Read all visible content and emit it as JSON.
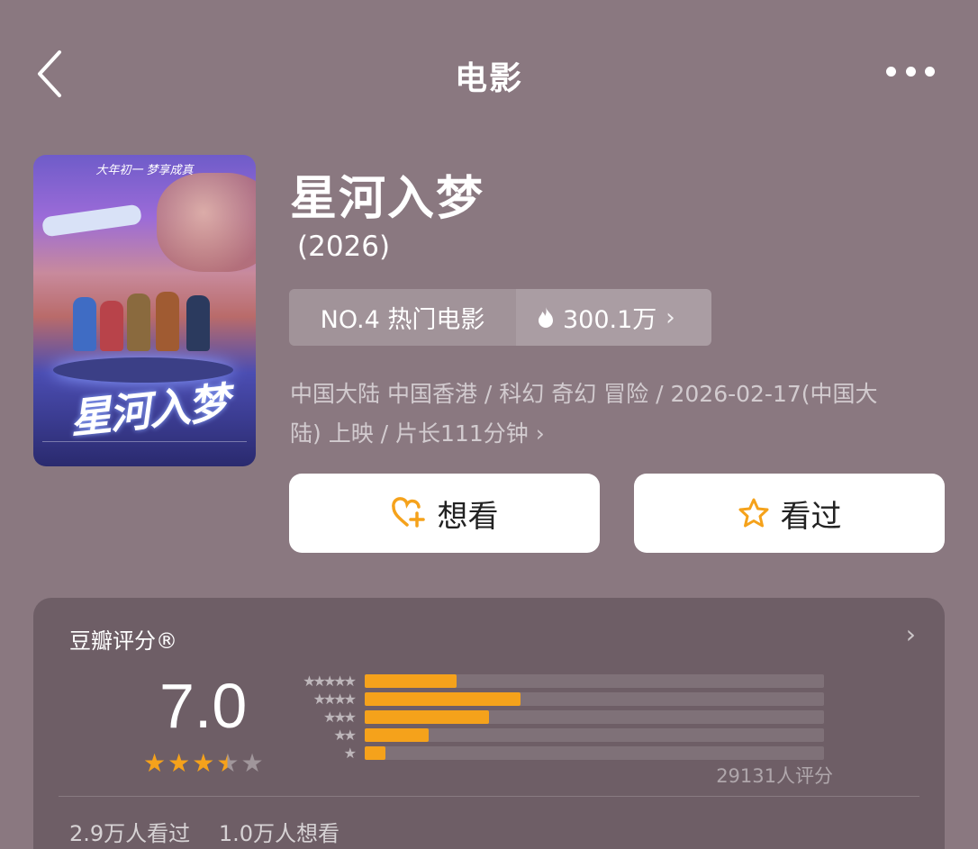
{
  "nav": {
    "title": "电影",
    "back_icon": "chevron-left-icon",
    "more_icon": "more-dots-icon"
  },
  "movie": {
    "name": "星河入梦",
    "year": "(2026)",
    "poster": {
      "slogan": "大年初一 梦享成真",
      "title_art": "星河入梦"
    },
    "rank": {
      "label": "NO.4 热门电影",
      "heat": "300.1万",
      "heat_icon": "flame-icon"
    },
    "meta_line1": "中国大陆 中国香港 / 科幻 奇幻 冒险 / 2026-02-17(中国大",
    "meta_line2": "陆) 上映 / 片长111分钟"
  },
  "actions": {
    "want_label": "想看",
    "want_icon": "heart-plus-icon",
    "seen_label": "看过",
    "seen_icon": "star-outline-icon",
    "accent": "#f5a21b"
  },
  "rating": {
    "title": "豆瓣评分®",
    "score": "7.0",
    "stars_value": 3.5,
    "votes": "29131人评分",
    "distribution": [
      {
        "stars": 5,
        "fraction": 0.2
      },
      {
        "stars": 4,
        "fraction": 0.34
      },
      {
        "stars": 3,
        "fraction": 0.27
      },
      {
        "stars": 2,
        "fraction": 0.14
      },
      {
        "stars": 1,
        "fraction": 0.045
      }
    ],
    "seen_count": "2.9万人看过",
    "want_count": "1.0万人想看"
  }
}
